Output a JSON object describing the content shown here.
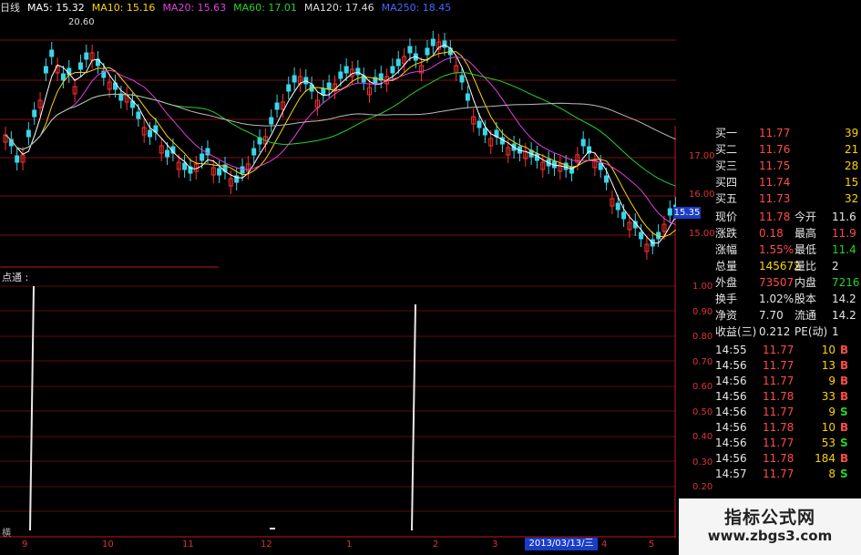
{
  "header": {
    "partial_label": "日线",
    "ma": [
      {
        "label": "MA5: 15.32",
        "color": "#ffffff"
      },
      {
        "label": "MA10: 15.16",
        "color": "#ffd400"
      },
      {
        "label": "MA20: 15.63",
        "color": "#e040e0"
      },
      {
        "label": "MA60: 17.01",
        "color": "#25d325"
      },
      {
        "label": "MA120: 17.46",
        "color": "#dddddd"
      },
      {
        "label": "MA250: 18.45",
        "color": "#4466ff"
      }
    ]
  },
  "price_chart": {
    "high_label": "20.60",
    "scale": [
      "17.00",
      "16.00",
      "15.00"
    ],
    "current_tag": "15.35"
  },
  "oscillator": {
    "title": "点通 :",
    "bottom_label": "横",
    "scale": [
      "1.00",
      "0.90",
      "0.80",
      "0.70",
      "0.60",
      "0.50",
      "0.40",
      "0.30",
      "0.20"
    ]
  },
  "x_axis": {
    "ticks": [
      "9",
      "10",
      "11",
      "12",
      "1",
      "2",
      "3",
      "4",
      "5"
    ],
    "cursor_date": "2013/03/13/三"
  },
  "quote_panel": {
    "bids": [
      {
        "label": "买一",
        "price": "11.77",
        "vol": "39"
      },
      {
        "label": "买二",
        "price": "11.76",
        "vol": "21"
      },
      {
        "label": "买三",
        "price": "11.75",
        "vol": "28"
      },
      {
        "label": "买四",
        "price": "11.74",
        "vol": "15"
      },
      {
        "label": "买五",
        "price": "11.73",
        "vol": "32"
      }
    ],
    "stats": [
      {
        "label": "现价",
        "value": "11.78",
        "label2": "今开",
        "value2": "11.6",
        "vcolor": "red",
        "v2color": "wht"
      },
      {
        "label": "涨跌",
        "value": "0.18",
        "label2": "最高",
        "value2": "11.9",
        "vcolor": "red",
        "v2color": "red"
      },
      {
        "label": "涨幅",
        "value": "1.55%",
        "label2": "最低",
        "value2": "11.4",
        "vcolor": "red",
        "v2color": "grn"
      },
      {
        "label": "总量",
        "value": "145672",
        "label2": "量比",
        "value2": "2",
        "vcolor": "yel",
        "v2color": "wht"
      },
      {
        "label": "外盘",
        "value": "73507",
        "label2": "内盘",
        "value2": "7216",
        "vcolor": "red",
        "v2color": "grn"
      },
      {
        "label": "换手",
        "value": "1.02%",
        "label2": "股本",
        "value2": "14.2",
        "vcolor": "wht",
        "v2color": "wht"
      },
      {
        "label": "净资",
        "value": "7.70",
        "label2": "流通",
        "value2": "14.2",
        "vcolor": "wht",
        "v2color": "wht"
      },
      {
        "label": "收益(三)",
        "value": "0.212",
        "label2": "PE(动)",
        "value2": "1",
        "vcolor": "wht",
        "v2color": "wht"
      }
    ],
    "ticks": [
      {
        "time": "14:55",
        "price": "11.77",
        "vol": "10",
        "side": "B"
      },
      {
        "time": "14:56",
        "price": "11.77",
        "vol": "13",
        "side": "B"
      },
      {
        "time": "14:56",
        "price": "11.77",
        "vol": "9",
        "side": "B"
      },
      {
        "time": "14:56",
        "price": "11.78",
        "vol": "33",
        "side": "B"
      },
      {
        "time": "14:56",
        "price": "11.77",
        "vol": "9",
        "side": "S"
      },
      {
        "time": "14:56",
        "price": "11.78",
        "vol": "10",
        "side": "B"
      },
      {
        "time": "14:56",
        "price": "11.77",
        "vol": "53",
        "side": "S"
      },
      {
        "time": "14:56",
        "price": "11.78",
        "vol": "184",
        "side": "B"
      },
      {
        "time": "14:57",
        "price": "11.77",
        "vol": "8",
        "side": "S"
      }
    ]
  },
  "watermark": {
    "title": "指标公式网",
    "url": "www.zbgs3.com"
  }
}
